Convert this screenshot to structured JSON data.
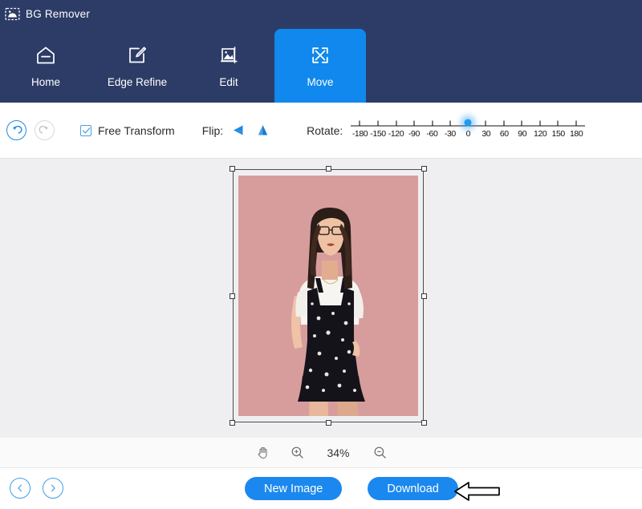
{
  "app": {
    "title": "BG Remover",
    "logo_icon": "image-dashed-icon"
  },
  "tabs": [
    {
      "label": "Home",
      "icon": "home-icon",
      "active": false
    },
    {
      "label": "Edge Refine",
      "icon": "edge-refine-icon",
      "active": false
    },
    {
      "label": "Edit",
      "icon": "edit-image-icon",
      "active": false
    },
    {
      "label": "Move",
      "icon": "move-arrows-icon",
      "active": true
    }
  ],
  "toolbar": {
    "undo_icon": "undo-arrow-icon",
    "redo_icon": "redo-arrow-icon",
    "free_transform_label": "Free Transform",
    "free_transform_checked": true,
    "flip_label": "Flip:",
    "flip_horizontal_icon": "flip-horizontal-icon",
    "flip_vertical_icon": "flip-vertical-icon",
    "rotate_label": "Rotate:",
    "rotate_value": 0,
    "rotate_min": -180,
    "rotate_max": 180,
    "rotate_ticks": [
      "-180",
      "-150",
      "-120",
      "-90",
      "-60",
      "-30",
      "0",
      "30",
      "60",
      "90",
      "120",
      "150",
      "180"
    ]
  },
  "canvas": {
    "background_color": "#efeff1",
    "photo_background_color": "#d79d9d",
    "selection_active": true,
    "handle_count": 8
  },
  "zoombar": {
    "hand_icon": "hand-tool-icon",
    "zoom_in_icon": "zoom-in-icon",
    "zoom_value": "34%",
    "zoom_out_icon": "zoom-out-icon"
  },
  "footer": {
    "prev_icon": "chevron-left-icon",
    "next_icon": "chevron-right-icon",
    "new_image_label": "New Image",
    "download_label": "Download",
    "annotation_icon": "left-arrow-annotation"
  },
  "colors": {
    "header_navy": "#2d3c66",
    "accent_blue": "#1b88ef",
    "active_tab_blue": "#1088ed",
    "canvas_gray": "#efeff1",
    "photo_pink": "#d79d9d"
  }
}
